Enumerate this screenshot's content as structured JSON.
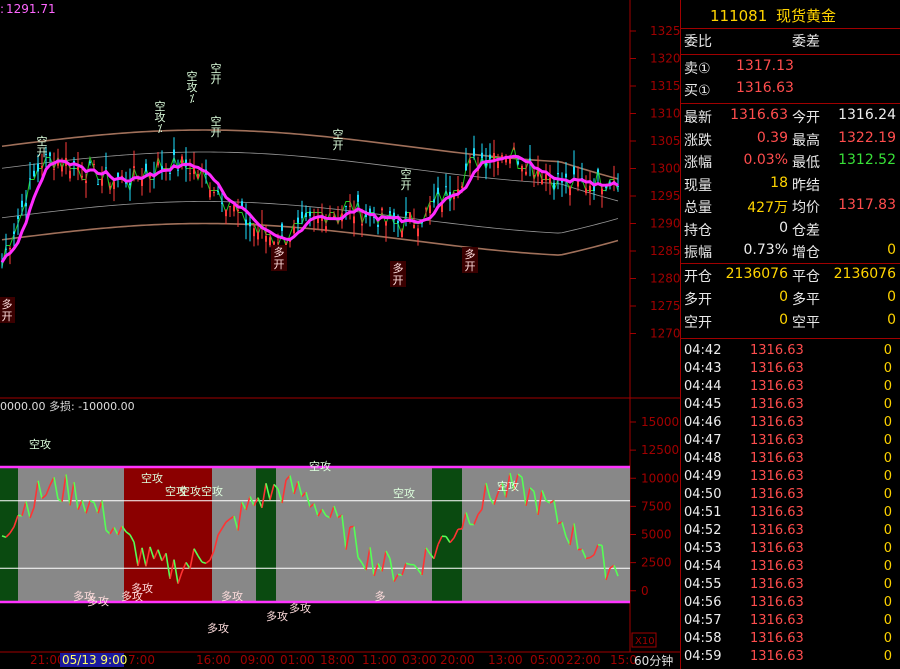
{
  "colors": {
    "up": "#ff3b3b",
    "down": "#1ee0ff",
    "signal_short": "#ddffdd",
    "signal_long": "#ffdddd",
    "grid": "#8b0000",
    "band": "#a0705a",
    "ma": "#ff2bff"
  },
  "main_chart": {
    "top_left_value": "1291.71",
    "y_ticks": [
      "1325",
      "1320",
      "1315",
      "1310",
      "1305",
      "1300",
      "1295",
      "1290",
      "1285",
      "1280",
      "1275",
      "1270"
    ],
    "signals_short": [
      "空\n开",
      "空\n攻\n⁒",
      "空\n攻\n⁒",
      "空\n开",
      "空\n开",
      "空\n开",
      "空\n开"
    ],
    "signals_long": [
      "多\n开",
      "多\n开",
      "多\n开",
      "多\n开"
    ]
  },
  "sub_chart": {
    "header": "0000.00  多损: -10000.00",
    "y_ticks": [
      "15000",
      "12500",
      "10000",
      "7500",
      "5000",
      "2500",
      "0"
    ],
    "x10_label": "X10",
    "signals_short": [
      "空攻",
      "空攻",
      "空攻",
      "空攻",
      "空攻",
      "空攻",
      "空攻",
      "空攻"
    ],
    "signals_long": [
      "多攻",
      "多攻",
      "多攻",
      "多攻",
      "多攻",
      "多攻",
      "多攻",
      "多攻",
      "多"
    ]
  },
  "time_axis": {
    "labels": [
      "21:00",
      "05/13  9:00",
      "7:00",
      "16:00",
      "09:00",
      "01:00",
      "18:00",
      "11:00",
      "03:00",
      "20:00",
      "13:00",
      "05:00",
      "22:00",
      "15:0"
    ],
    "period": "60分钟"
  },
  "quote": {
    "code": "111081",
    "name": "现货黄金",
    "weibi_label": "委比",
    "weicha_label": "委差",
    "sell1_label": "卖①",
    "sell1_price": "1317.13",
    "buy1_label": "买①",
    "buy1_price": "1316.63",
    "stats_left": [
      {
        "label": "最新",
        "value": "1316.63",
        "color": "red"
      },
      {
        "label": "涨跌",
        "value": "0.39",
        "color": "red"
      },
      {
        "label": "涨幅",
        "value": "0.03%",
        "color": "red"
      },
      {
        "label": "现量",
        "value": "18",
        "color": "yel"
      },
      {
        "label": "总量",
        "value": "427万",
        "color": "yel"
      },
      {
        "label": "持仓",
        "value": "0",
        "color": "wht"
      },
      {
        "label": "振幅",
        "value": "0.73%",
        "color": "wht"
      }
    ],
    "stats_right": [
      {
        "label": "今开",
        "value": "1316.24",
        "color": "wht"
      },
      {
        "label": "最高",
        "value": "1322.19",
        "color": "red"
      },
      {
        "label": "最低",
        "value": "1312.52",
        "color": "grn"
      },
      {
        "label": "昨结",
        "value": "",
        "color": "wht"
      },
      {
        "label": "均价",
        "value": "1317.83",
        "color": "red"
      },
      {
        "label": "仓差",
        "value": "",
        "color": "wht"
      },
      {
        "label": "增仓",
        "value": "0",
        "color": "yel"
      }
    ],
    "open_label": "开仓",
    "open_value": "2136076",
    "close_label": "平仓",
    "close_value": "2136076",
    "long_open_label": "多开",
    "long_open_value": "0",
    "long_close_label": "多平",
    "long_close_value": "0",
    "short_open_label": "空开",
    "short_open_value": "0",
    "short_close_label": "空平",
    "short_close_value": "0"
  },
  "ticks": [
    {
      "time": "04:42",
      "price": "1316.63",
      "vol": "0"
    },
    {
      "time": "04:43",
      "price": "1316.63",
      "vol": "0"
    },
    {
      "time": "04:44",
      "price": "1316.63",
      "vol": "0"
    },
    {
      "time": "04:45",
      "price": "1316.63",
      "vol": "0"
    },
    {
      "time": "04:46",
      "price": "1316.63",
      "vol": "0"
    },
    {
      "time": "04:47",
      "price": "1316.63",
      "vol": "0"
    },
    {
      "time": "04:48",
      "price": "1316.63",
      "vol": "0"
    },
    {
      "time": "04:49",
      "price": "1316.63",
      "vol": "0"
    },
    {
      "time": "04:50",
      "price": "1316.63",
      "vol": "0"
    },
    {
      "time": "04:51",
      "price": "1316.63",
      "vol": "0"
    },
    {
      "time": "04:52",
      "price": "1316.63",
      "vol": "0"
    },
    {
      "time": "04:53",
      "price": "1316.63",
      "vol": "0"
    },
    {
      "time": "04:54",
      "price": "1316.63",
      "vol": "0"
    },
    {
      "time": "04:55",
      "price": "1316.63",
      "vol": "0"
    },
    {
      "time": "04:56",
      "price": "1316.63",
      "vol": "0"
    },
    {
      "time": "04:57",
      "price": "1316.63",
      "vol": "0"
    },
    {
      "time": "04:58",
      "price": "1316.63",
      "vol": "0"
    },
    {
      "time": "04:59",
      "price": "1316.63",
      "vol": "0"
    }
  ]
}
